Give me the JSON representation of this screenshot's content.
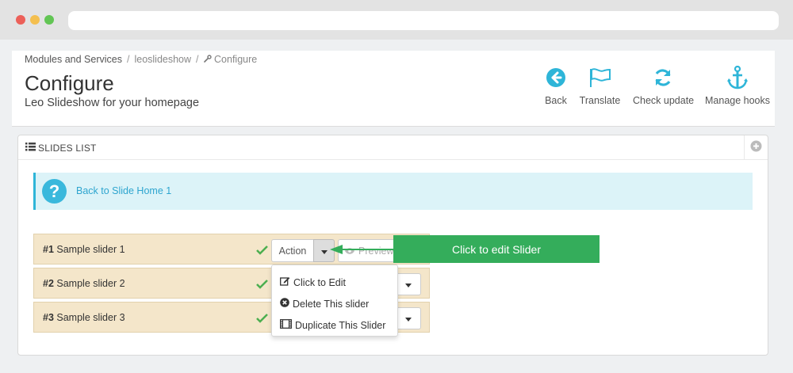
{
  "breadcrumb": {
    "items": [
      "Modules and Services",
      "leoslideshow",
      "Configure"
    ],
    "separator": "/"
  },
  "page": {
    "title": "Configure",
    "subtitle": "Leo Slideshow for your homepage"
  },
  "toolbar": {
    "back": "Back",
    "translate": "Translate",
    "check_update": "Check update",
    "manage_hooks": "Manage hooks"
  },
  "panel": {
    "title": "SLIDES LIST"
  },
  "alert": {
    "link": "Back to Slide Home 1",
    "icon_char": "?"
  },
  "slides": [
    {
      "number": "#1",
      "name": "Sample slider 1"
    },
    {
      "number": "#2",
      "name": "Sample slider 2"
    },
    {
      "number": "#3",
      "name": "Sample slider 3"
    }
  ],
  "row_actions": {
    "action_label": "Action",
    "preview_label": "Preview"
  },
  "dropdown": {
    "items": [
      "Click to Edit",
      "Delete This slider",
      "Duplicate This Slider"
    ]
  },
  "tooltip": {
    "text": "Click to edit Slider"
  },
  "colors": {
    "accent": "#2eb5d8",
    "row_bg": "#f4e6ca",
    "tooltip_bg": "#34ad5b",
    "check": "#4caf50"
  },
  "icons": {
    "back": "arrow-left-circle-icon",
    "translate": "flag-icon",
    "check_update": "refresh-icon",
    "manage_hooks": "anchor-icon",
    "panel": "list-icon",
    "add": "plus-circle-icon",
    "alert": "question-circle-icon",
    "status": "check-icon",
    "edit": "edit-icon",
    "delete": "times-circle-icon",
    "duplicate": "film-icon",
    "preview": "eye-icon"
  }
}
